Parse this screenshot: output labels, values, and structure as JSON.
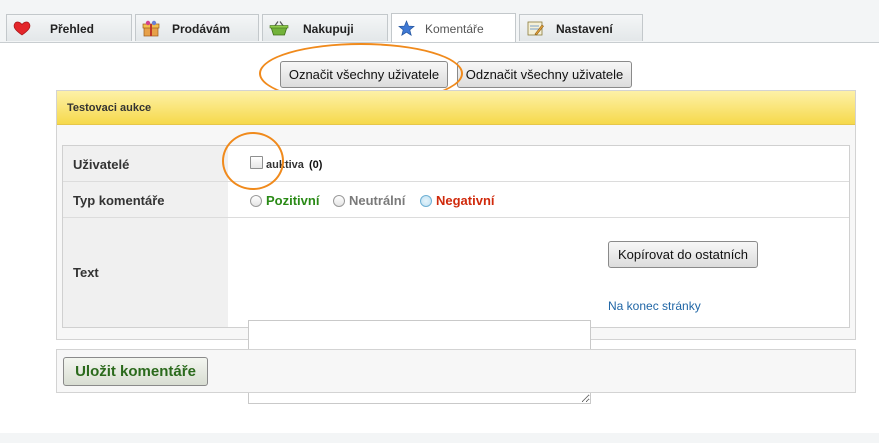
{
  "tabs": [
    {
      "label": "Přehled",
      "icon": "heart-icon"
    },
    {
      "label": "Prodávám",
      "icon": "gift-icon"
    },
    {
      "label": "Nakupuji",
      "icon": "basket-icon"
    },
    {
      "label": "Komentáře",
      "icon": "star-icon"
    },
    {
      "label": "Nastavení",
      "icon": "settings-note-icon"
    }
  ],
  "active_tab": "Komentáře",
  "actions": {
    "select_all": "Označit všechny uživatele",
    "deselect_all": "Odznačit všechny uživatele"
  },
  "auction": {
    "title": "Testovaci aukce",
    "users_label": "Uživatelé",
    "user_name": "auktiva",
    "user_count": "(0)",
    "type_label": "Typ komentáře",
    "types": [
      {
        "label": "Pozitivní",
        "color": "#2a8a16",
        "selected": false
      },
      {
        "label": "Neutrální",
        "color": "#7a7a7a",
        "selected": false
      },
      {
        "label": "Negativní",
        "color": "#d02a0c",
        "selected": true
      }
    ],
    "text_label": "Text",
    "text_value": "",
    "copy_button": "Kopírovat do ostatních",
    "end_link": "Na konec stránky"
  },
  "save_button": "Uložit komentáře",
  "colors": {
    "header_yellow": "#f6d94c",
    "highlight_orange": "#f08a1c",
    "link_blue": "#2066a6"
  }
}
